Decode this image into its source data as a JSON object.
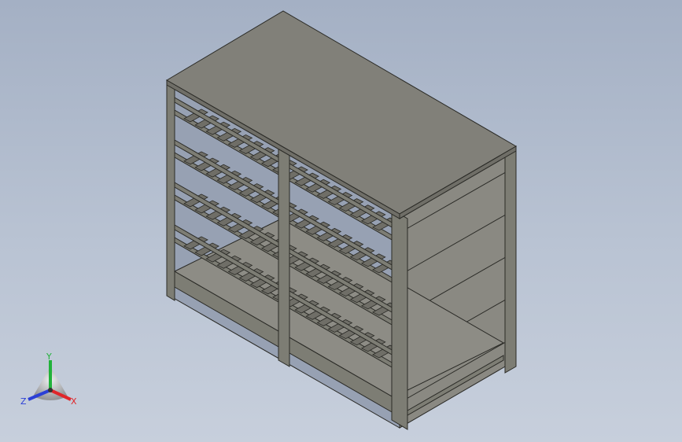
{
  "viewport": {
    "background_top": "#a4b0c4",
    "background_bottom": "#c7cfdc"
  },
  "model": {
    "description_icon": "shelving-rack-3d-model",
    "frame_color": "#7d7d74",
    "edge_color": "#2a2a26",
    "top_panel_color": "#818079",
    "side_panel_color": "#8a8982",
    "front_shade_color": "#6f6e67"
  },
  "triad": {
    "x_label": "X",
    "y_label": "Y",
    "z_label": "Z",
    "x_color": "#e0262a",
    "y_color": "#21b23a",
    "z_color": "#2b3fd6"
  }
}
